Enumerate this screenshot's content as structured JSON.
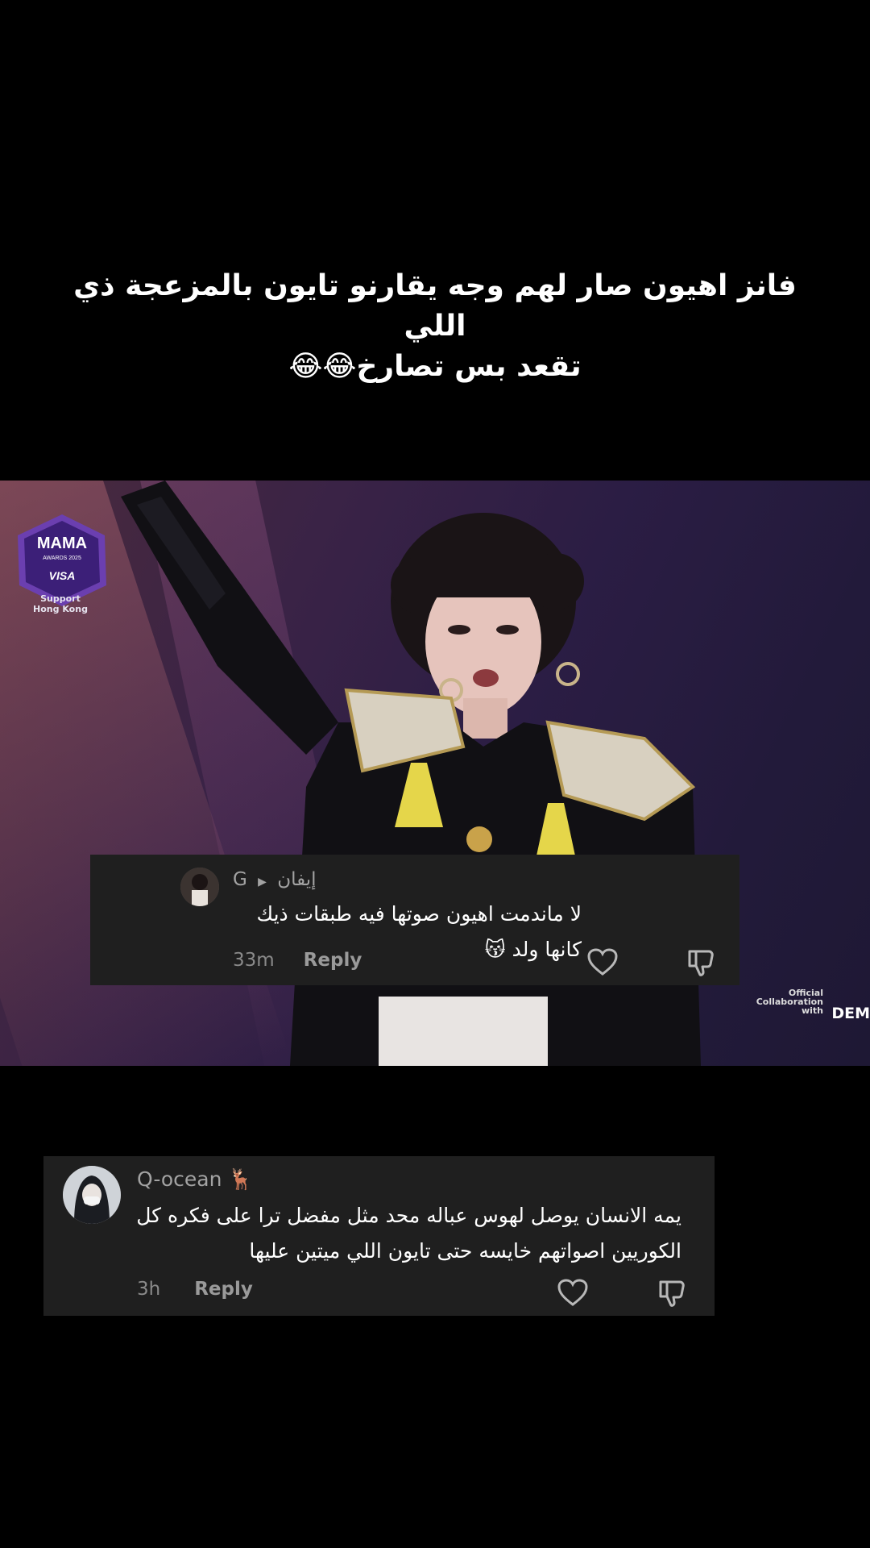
{
  "caption": {
    "line1": "فانز اهيون صار لهم وجه يقارنو تايون بالمزعجة ذي اللي",
    "line2": "تقعد بس تصارخ😂😂"
  },
  "video": {
    "logo_title": "MAMA",
    "logo_sub": "AWARDS 2025",
    "logo_brand": "VISA",
    "support_line1": "Support",
    "support_line2": "Hong Kong",
    "official_line1": "Official",
    "official_line2": "Collaboration",
    "official_line3": "with",
    "partner": "DEM"
  },
  "comments": [
    {
      "username": "G",
      "reply_to": "إيفان",
      "text": "لا ماندمت اهيون صوتها فيه طبقات ذيك كانها ولد 😽",
      "time": "33m",
      "reply_label": "Reply"
    },
    {
      "username": "Q-ocean 🦌",
      "text": "يمه الانسان يوصل لهوس عباله محد مثل مفضل ترا على فكره كل الكوريين اصواتهم خايسه حتى تايون اللي ميتين عليها",
      "time": "3h",
      "reply_label": "Reply"
    }
  ],
  "icons": {
    "like": "heart-icon",
    "dislike": "thumbs-down-icon",
    "reply_arrow": "play-triangle-icon"
  },
  "colors": {
    "background": "#000000",
    "comment_bg": "#1f1f1f",
    "muted_text": "#a3a3a3"
  }
}
